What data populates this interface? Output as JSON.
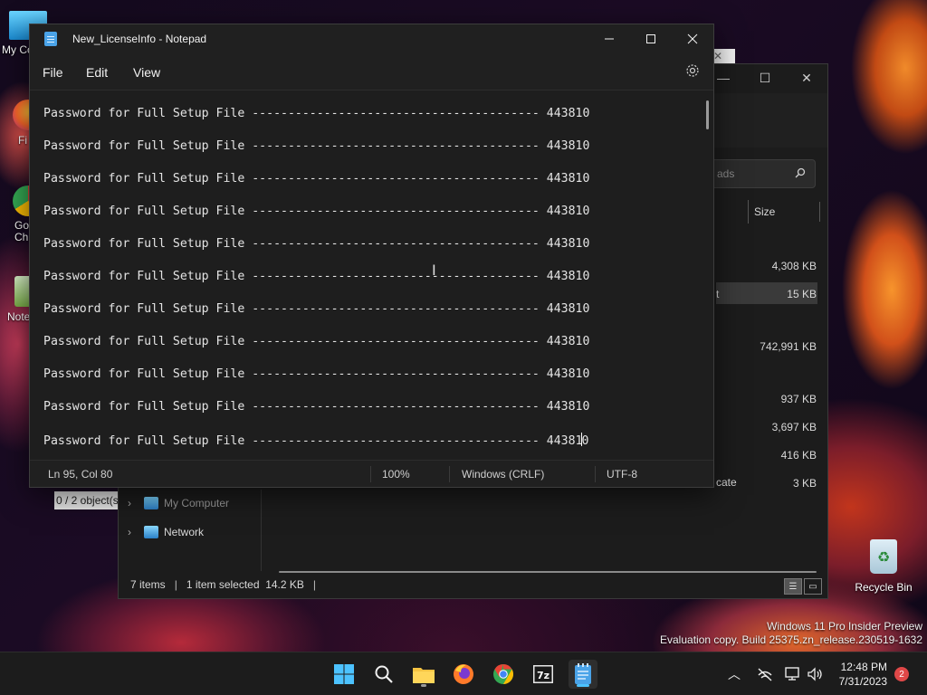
{
  "desktop": {
    "icons": [
      {
        "label": "My Co"
      },
      {
        "label": "Fi"
      },
      {
        "label": "Go Ch"
      },
      {
        "label": "Note"
      }
    ],
    "recycle_bin": "Recycle Bin",
    "watermark_line1": "Windows 11 Pro Insider Preview",
    "watermark_line2": "Evaluation copy. Build 25375.zn_release.230519-1632"
  },
  "explorer": {
    "search_placeholder": "ads",
    "column_size": "Size",
    "rows": [
      {
        "size": "4,308 KB"
      },
      {
        "label": "t",
        "size": "15 KB"
      },
      {
        "size": "742,991 KB"
      },
      {
        "size": "937 KB"
      },
      {
        "size": "3,697 KB"
      },
      {
        "size": "416 KB"
      },
      {
        "label": "cate",
        "size": "3 KB"
      }
    ],
    "nav": [
      "My Computer",
      "Network"
    ],
    "objects_strip": "0 / 2 object(s)",
    "status_items": "7 items",
    "status_selected": "1 item selected  14.2 KB"
  },
  "notepad": {
    "title": "New_LicenseInfo - Notepad",
    "menu": [
      "File",
      "Edit",
      "View"
    ],
    "line_prefix": "Password for Full Setup File ---------------------------------------- ",
    "lines": [
      "443810",
      "443810",
      "443810",
      "443810",
      "443810",
      "443810",
      "443810",
      "443810",
      "443810",
      "443810"
    ],
    "last_line_before_caret": "44381",
    "last_line_after_caret": "0",
    "status": {
      "position": "Ln 95, Col 80",
      "zoom": "100%",
      "line_ending": "Windows (CRLF)",
      "encoding": "UTF-8"
    }
  },
  "taskbar": {
    "clock_time": "12:48 PM",
    "clock_date": "7/31/2023",
    "notification_count": "2"
  }
}
